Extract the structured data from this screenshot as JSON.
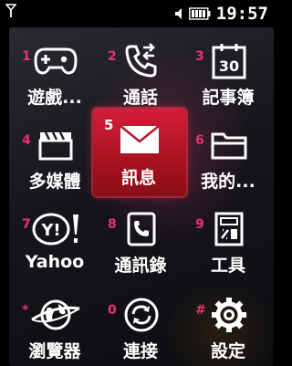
{
  "status": {
    "time": "19:57",
    "icons": [
      "antenna-signal-icon",
      "speaker-volume-icon",
      "battery-full-icon"
    ]
  },
  "menu": {
    "items": [
      {
        "key": "1",
        "label": "遊戲...",
        "icon": "gamepad-icon"
      },
      {
        "key": "2",
        "label": "通話",
        "icon": "phone-call-icon"
      },
      {
        "key": "3",
        "label": "記事簿",
        "icon": "calendar-icon"
      },
      {
        "key": "4",
        "label": "多媒體",
        "icon": "clapperboard-icon"
      },
      {
        "key": "5",
        "label": "訊息",
        "icon": "envelope-icon",
        "selected": true
      },
      {
        "key": "6",
        "label": "我的...",
        "icon": "folder-icon"
      },
      {
        "key": "7",
        "label": "Yahoo",
        "icon": "yahoo-icon"
      },
      {
        "key": "8",
        "label": "通訊錄",
        "icon": "phonebook-icon"
      },
      {
        "key": "9",
        "label": "工具",
        "icon": "calculator-icon"
      },
      {
        "key": "*",
        "label": "瀏覽器",
        "icon": "globe-icon"
      },
      {
        "key": "0",
        "label": "連接",
        "icon": "sync-connect-icon"
      },
      {
        "key": "#",
        "label": "設定",
        "icon": "gear-icon"
      }
    ]
  },
  "calendar_day": "30",
  "yahoo_mark": "Y!",
  "colors": {
    "accent": "#e8326e",
    "selection": "#c4182c"
  }
}
